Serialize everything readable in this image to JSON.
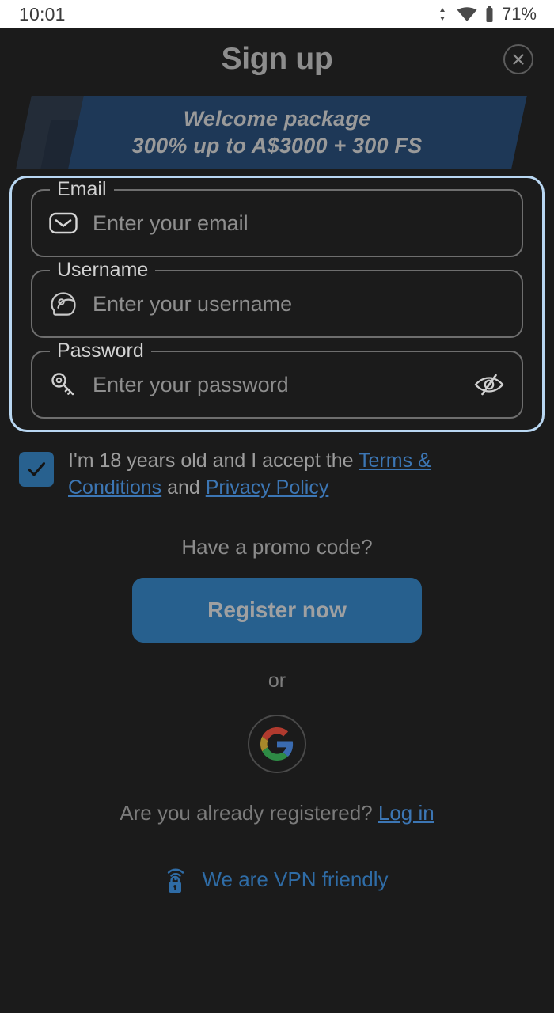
{
  "statusbar": {
    "time": "10:01",
    "battery": "71%",
    "icons": [
      "data-transfer-icon",
      "wifi-icon",
      "battery-icon"
    ]
  },
  "header": {
    "title": "Sign up",
    "close_icon": "close-icon"
  },
  "banner": {
    "line1": "Welcome package",
    "line2": "300% up to A$3000 + 300 FS",
    "bg_color": "#1e3857",
    "text_color": "#9a9a9a"
  },
  "form": {
    "focus_ring_color": "#b9d7f2",
    "fields": [
      {
        "id": "email",
        "label": "Email",
        "placeholder": "Enter your email",
        "value": "",
        "icon": "envelope-icon"
      },
      {
        "id": "username",
        "label": "Username",
        "placeholder": "Enter your username",
        "value": "",
        "icon": "helmet-icon"
      },
      {
        "id": "password",
        "label": "Password",
        "placeholder": "Enter your password",
        "value": "",
        "icon": "key-icon",
        "trailing_icon": "eye-off-icon"
      }
    ]
  },
  "terms": {
    "checked": true,
    "checkbox_color": "#28618f",
    "text_before": "I'm 18 years old and I accept the ",
    "link_terms": "Terms & Conditions",
    "text_middle": " and ",
    "link_privacy": "Privacy Policy",
    "link_color": "#3c76b4"
  },
  "promo": {
    "label": "Have a promo code?"
  },
  "register": {
    "label": "Register now",
    "bg_color": "#27608e",
    "text_color": "#9fa0a1"
  },
  "divider": {
    "label": "or"
  },
  "social": {
    "google_icon": "google-icon"
  },
  "footer": {
    "login_prompt": "Are you already registered? ",
    "login_link": "Log in",
    "vpn_icon": "vpn-lock-icon",
    "vpn_text": "We are VPN friendly",
    "vpn_color": "#2f6ca6"
  }
}
